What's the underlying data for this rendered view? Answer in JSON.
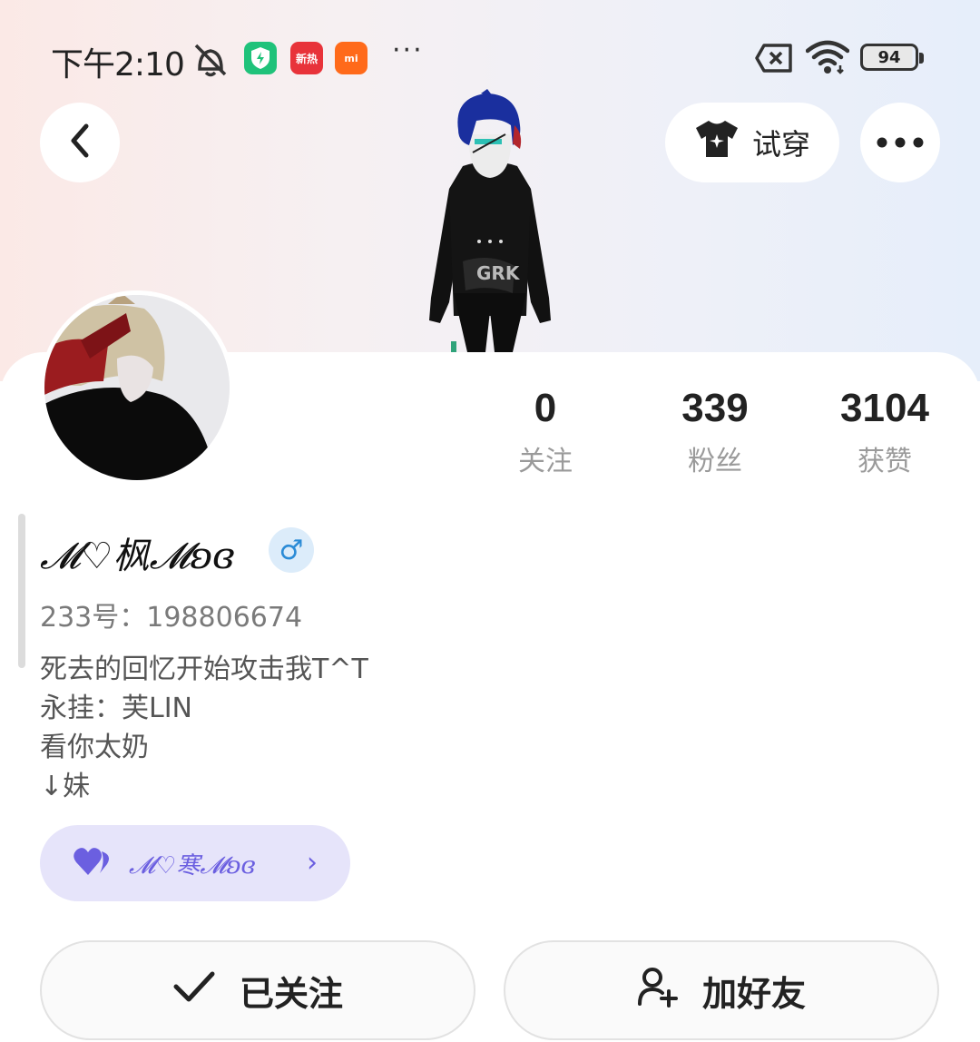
{
  "status_bar": {
    "time": "下午2:10",
    "apps": [
      {
        "name": "security-app",
        "label": "",
        "color": "#1fc27a"
      },
      {
        "name": "news-app",
        "label": "新热",
        "color": "#e8333a"
      },
      {
        "name": "mi-store-app",
        "label": "mi",
        "color": "#ff6a1a"
      }
    ],
    "more": "···",
    "battery": "94"
  },
  "header": {
    "try_on_label": "试穿"
  },
  "profile": {
    "username": "𝓜♡枫𝓜ʚɞ",
    "gender": "♂",
    "uid_label": "233号：198806674",
    "bio_lines": [
      "死去的回忆开始攻击我T^T",
      "永挂：芙LIN",
      "看你太奶",
      "↓妹"
    ]
  },
  "stats": [
    {
      "value": "0",
      "label": "关注"
    },
    {
      "value": "339",
      "label": "粉丝"
    },
    {
      "value": "3104",
      "label": "获赞"
    }
  ],
  "couple": {
    "name": "𝓜♡寒𝓜ʚɞ",
    "arrow": "›"
  },
  "actions": {
    "followed_label": "已关注",
    "add_friend_label": "加好友"
  },
  "colors": {
    "accent_purple": "#6b5fe0",
    "pill_bg": "#e6e4fa",
    "gender_blue": "#2b8bd6"
  }
}
